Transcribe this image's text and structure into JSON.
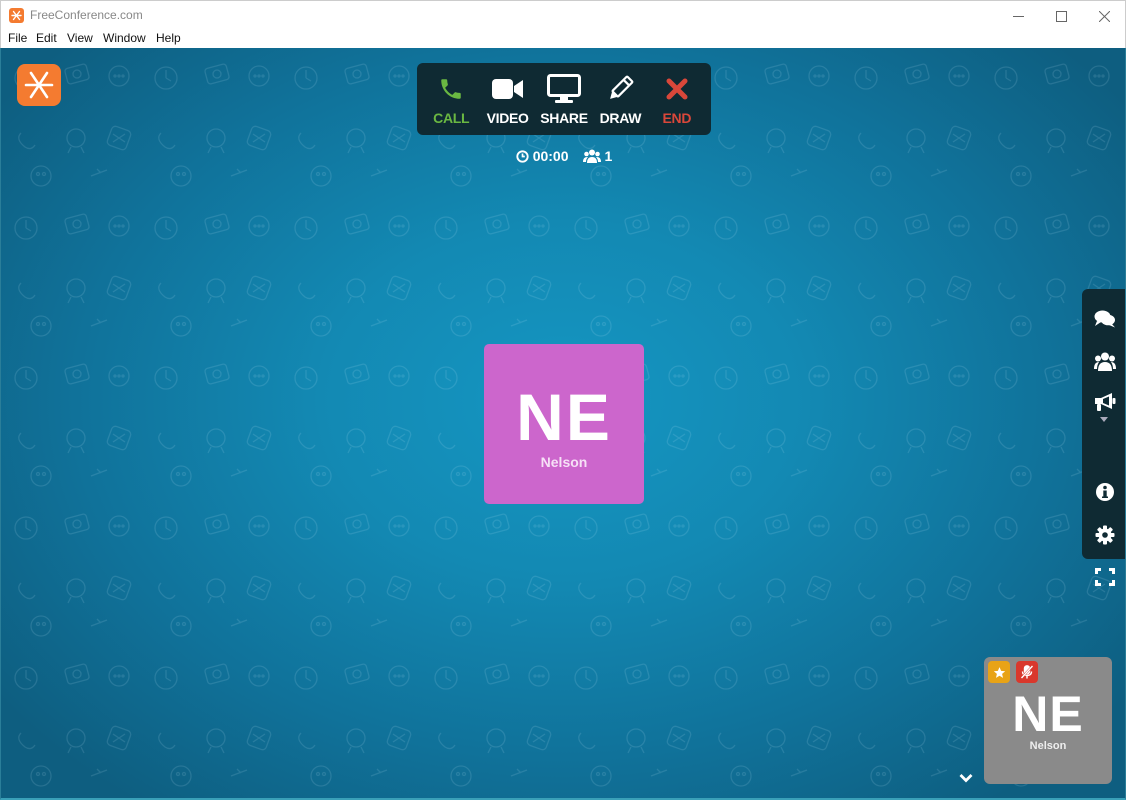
{
  "window": {
    "title": "FreeConference.com",
    "controls": {
      "minimize": "—",
      "maximize": "☐",
      "close": "✕"
    }
  },
  "menu": [
    "File",
    "Edit",
    "View",
    "Window",
    "Help"
  ],
  "toolbar": {
    "buttons": [
      {
        "label": "CALL",
        "icon": "phone-icon",
        "color": "#6ab842"
      },
      {
        "label": "VIDEO",
        "icon": "video-camera-icon",
        "color": "#ffffff"
      },
      {
        "label": "SHARE",
        "icon": "monitor-icon",
        "color": "#ffffff"
      },
      {
        "label": "DRAW",
        "icon": "pencil-icon",
        "color": "#ffffff"
      },
      {
        "label": "END",
        "icon": "close-x-icon",
        "color": "#d9473a"
      }
    ]
  },
  "status": {
    "timer": "00:00",
    "participants": "1"
  },
  "main_tile": {
    "initials": "NE",
    "name": "Nelson",
    "color": "#cc66cc"
  },
  "side_panel": {
    "items": [
      "chat-icon",
      "participants-icon",
      "megaphone-icon",
      "info-icon",
      "settings-icon",
      "fullscreen-icon"
    ]
  },
  "self_tile": {
    "initials": "NE",
    "name": "Nelson",
    "color": "#8a8a8a",
    "badges": [
      "star-icon",
      "mic-muted-icon"
    ]
  },
  "colors": {
    "brand": "#f47b30",
    "toolbar_bg": "#0f2a33",
    "stage_center": "#1596c2",
    "stage_edge": "#0e5e80"
  }
}
